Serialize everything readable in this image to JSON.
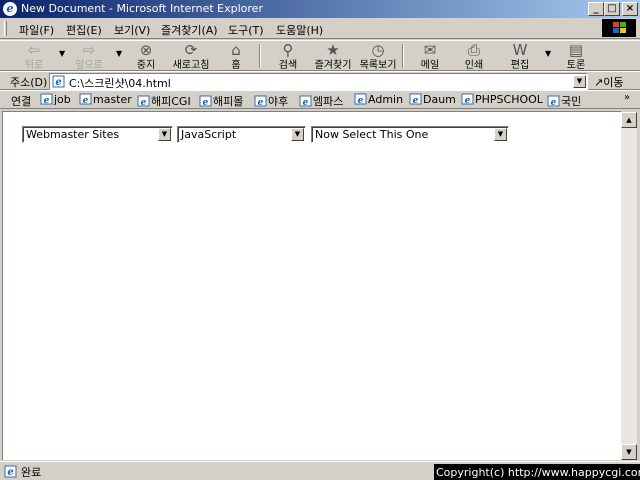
{
  "window": {
    "title": "New Document - Microsoft Internet Explorer",
    "controls": {
      "minimize": "_",
      "maximize": "□",
      "close": "×"
    }
  },
  "menu": {
    "items": [
      "파일(F)",
      "편집(E)",
      "보기(V)",
      "즐겨찾기(A)",
      "도구(T)",
      "도움말(H)"
    ]
  },
  "toolbar": {
    "buttons": [
      {
        "label": "뒤로",
        "icon": "back-arrow-icon",
        "glyph": "⇦"
      },
      {
        "label": "앞으로",
        "icon": "forward-arrow-icon",
        "glyph": "⇨"
      },
      {
        "label": "중지",
        "icon": "stop-icon",
        "glyph": "⊗"
      },
      {
        "label": "새로고침",
        "icon": "refresh-icon",
        "glyph": "⟳"
      },
      {
        "label": "홈",
        "icon": "home-icon",
        "glyph": "⌂"
      },
      {
        "label": "검색",
        "icon": "search-icon",
        "glyph": "⚲"
      },
      {
        "label": "즐겨찾기",
        "icon": "favorites-icon",
        "glyph": "★"
      },
      {
        "label": "목록보기",
        "icon": "history-icon",
        "glyph": "◷"
      },
      {
        "label": "메일",
        "icon": "mail-icon",
        "glyph": "✉"
      },
      {
        "label": "인쇄",
        "icon": "print-icon",
        "glyph": "⎙"
      },
      {
        "label": "편집",
        "icon": "edit-icon",
        "glyph": "W"
      },
      {
        "label": "토론",
        "icon": "discuss-icon",
        "glyph": "▤"
      }
    ]
  },
  "address": {
    "label": "주소(D)",
    "value": "C:\\스크린샷\\04.html",
    "go_label": "이동"
  },
  "links": {
    "label": "연결",
    "items": [
      "job",
      "master",
      "해피CGI",
      "해피몰",
      "야후",
      "엠파스",
      "Admin",
      "Daum",
      "PHPSCHOOL",
      "국민"
    ],
    "more": "»"
  },
  "content": {
    "selects": [
      {
        "value": "Webmaster Sites"
      },
      {
        "value": "JavaScript"
      },
      {
        "value": "Now Select This One"
      }
    ]
  },
  "status": {
    "text": "완료",
    "copyright": "Copyright(c) http://www.happycgi.com"
  }
}
